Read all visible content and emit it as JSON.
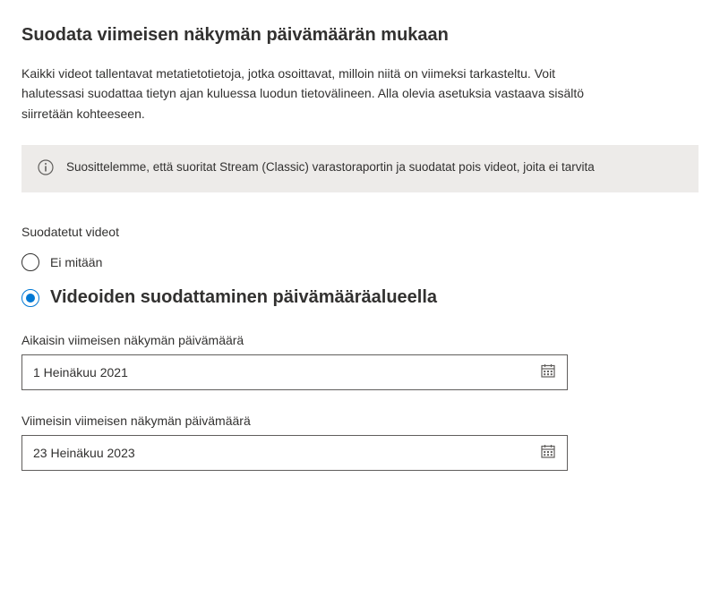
{
  "title": "Suodata viimeisen näkymän päivämäärän mukaan",
  "description": "Kaikki videot tallentavat metatietotietoja, jotka osoittavat, milloin niitä on viimeksi tarkasteltu. Voit halutessasi suodattaa tietyn ajan kuluessa luodun tietovälineen. Alla olevia asetuksia vastaava sisältö siirretään kohteeseen.",
  "infoBanner": {
    "text": "Suosittelemme, että suoritat Stream (Classic) varastoraportin ja suodatat pois videot, joita ei tarvita"
  },
  "filterSection": {
    "label": "Suodatetut videot",
    "options": {
      "none": {
        "label": "Ei mitään",
        "selected": false
      },
      "dateRange": {
        "label": "Videoiden suodattaminen päivämääräalueella",
        "selected": true
      }
    }
  },
  "dateFields": {
    "earliest": {
      "label": "Aikaisin viimeisen näkymän päivämäärä",
      "value": "1 Heinäkuu 2021"
    },
    "latest": {
      "label": "Viimeisin viimeisen näkymän päivämäärä",
      "value": "23 Heinäkuu 2023"
    }
  }
}
